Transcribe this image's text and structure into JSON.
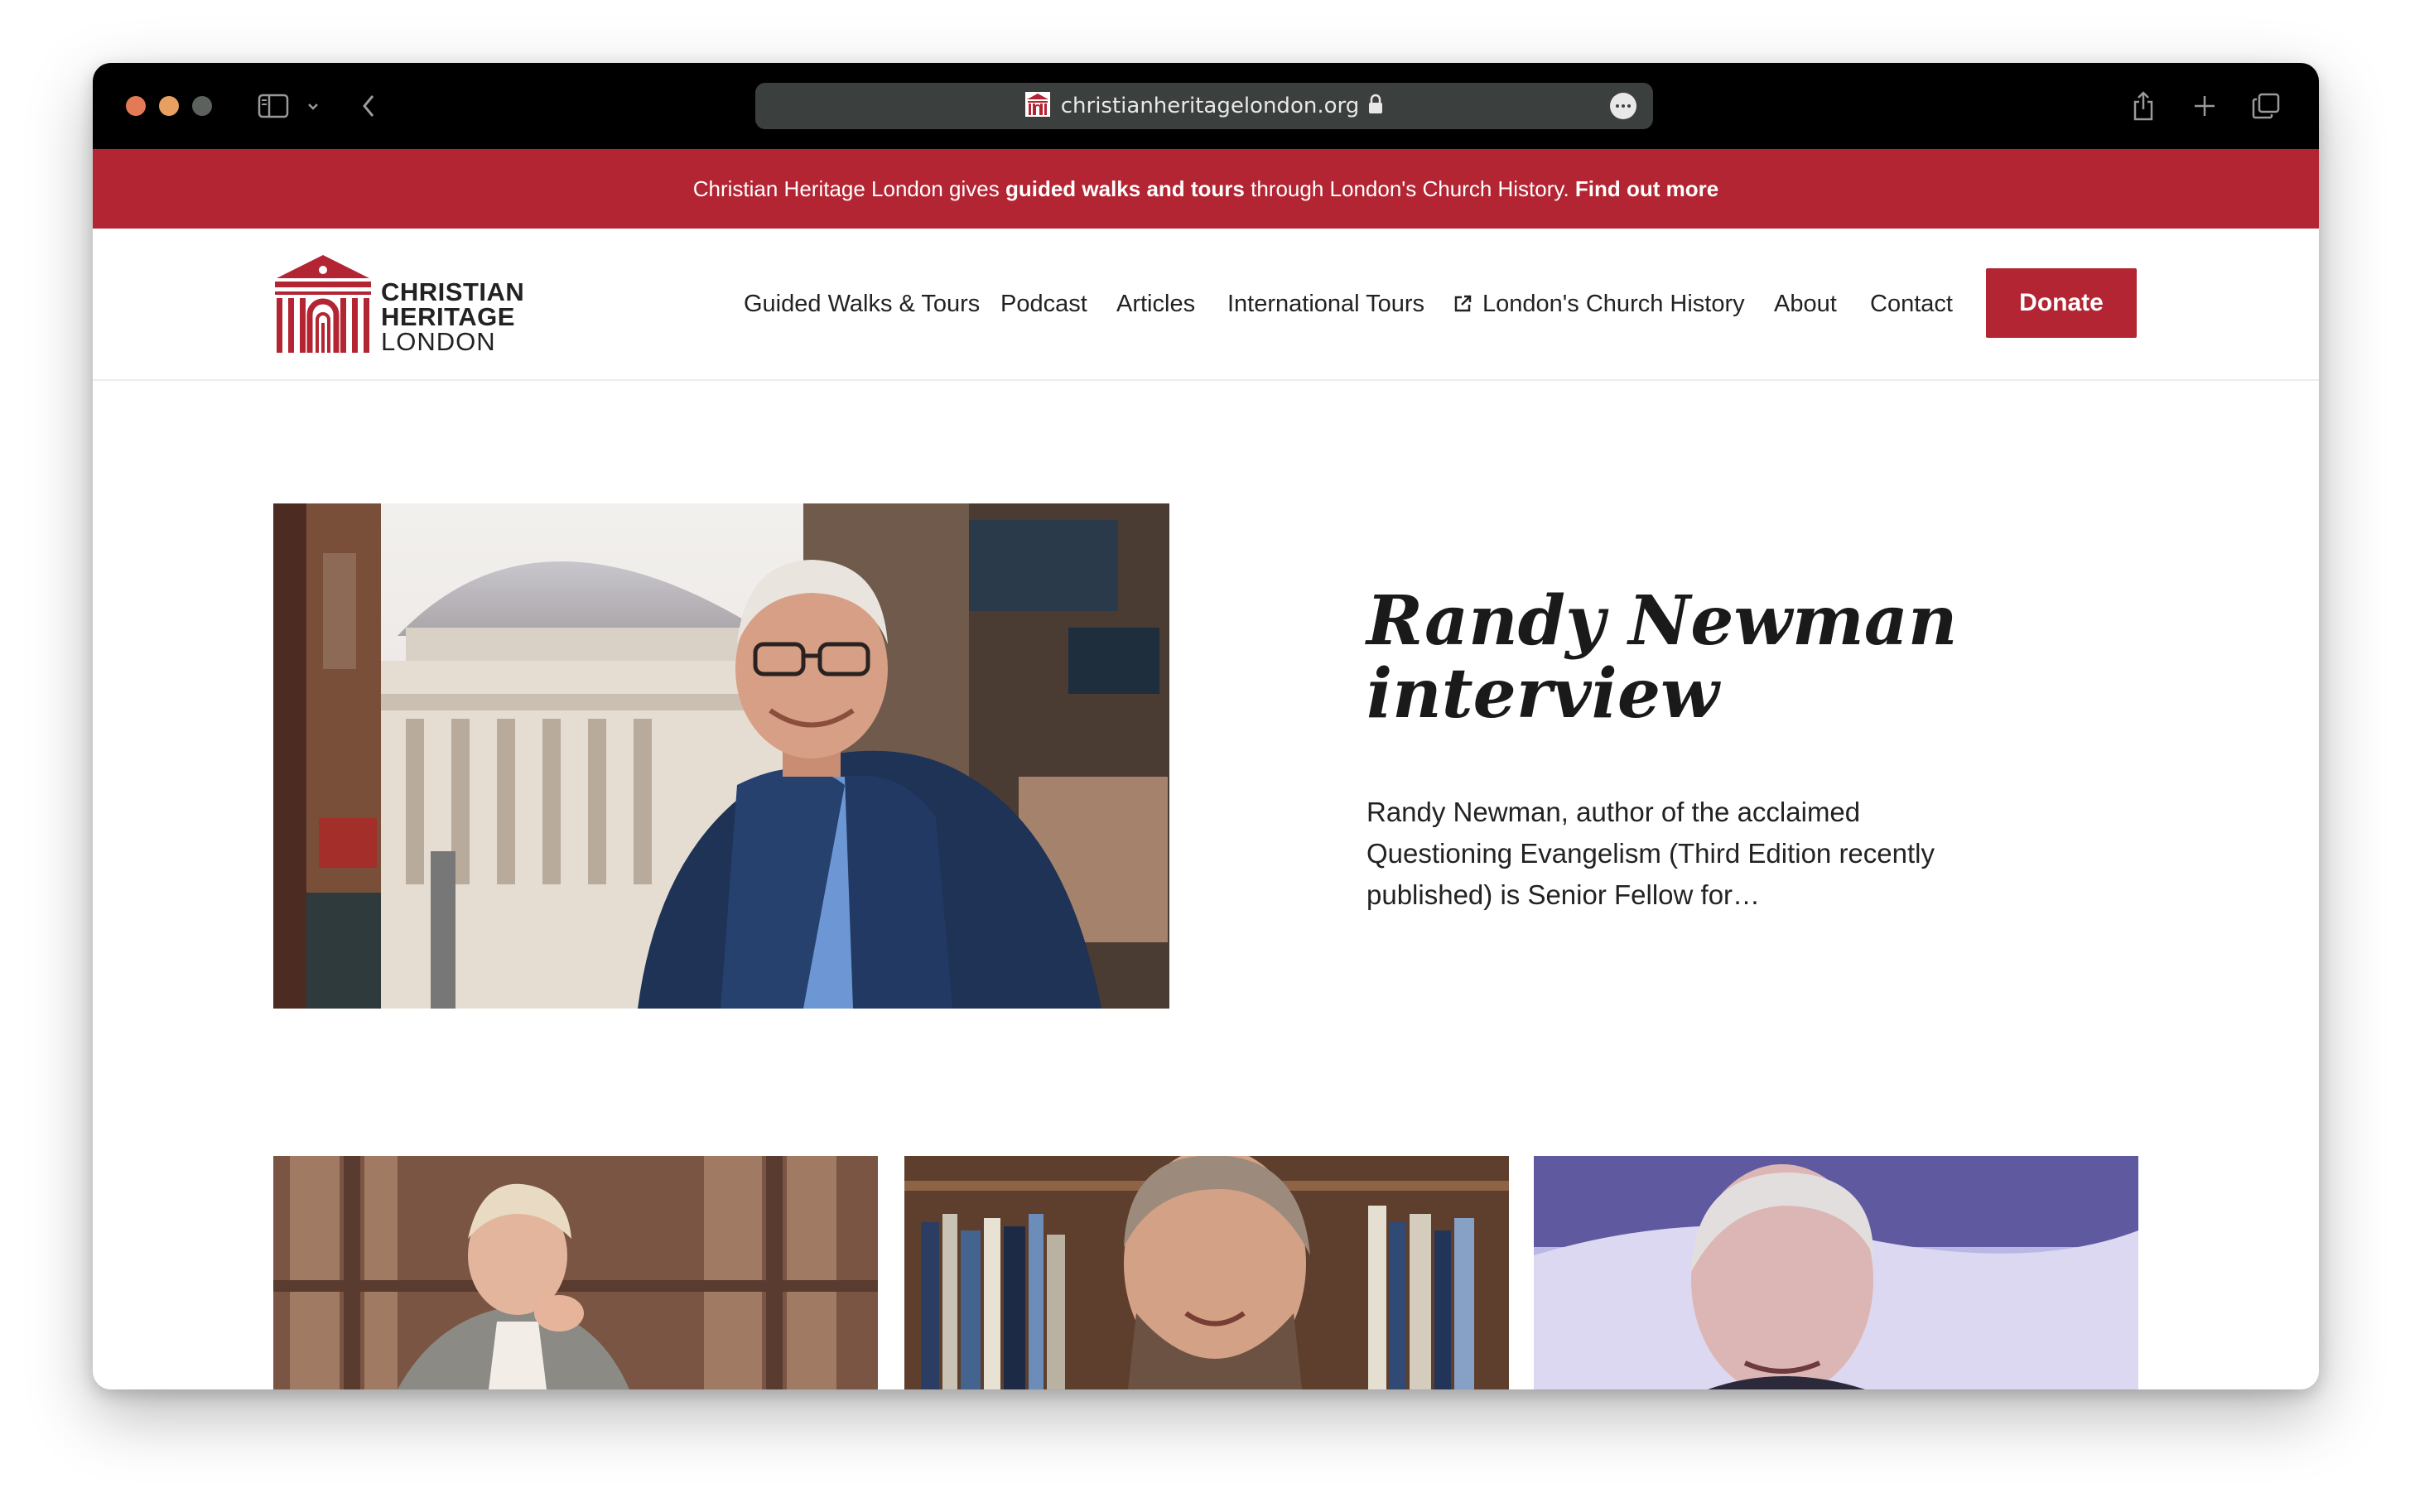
{
  "browser": {
    "url": "christianheritagelondon.org",
    "lock_icon": "lock-icon",
    "more_icon": "ellipsis-icon",
    "sidebar_icon": "sidebar-icon",
    "back_icon": "chevron-left-icon",
    "share_icon": "share-icon",
    "new_tab_icon": "plus-icon",
    "tabs_icon": "tabs-overview-icon"
  },
  "banner": {
    "part1": "Christian Heritage London gives ",
    "bold1": "guided walks and tours",
    "part2": " through London's Church History. ",
    "link": "Find out more"
  },
  "logo": {
    "line1": "CHRISTIAN",
    "line2": "HERITAGE",
    "line3": "LONDON"
  },
  "nav": {
    "items": [
      "Guided Walks & Tours",
      "Podcast",
      "Articles",
      "International Tours",
      "London's Church History",
      "About",
      "Contact"
    ],
    "external_icon": "external-link-icon",
    "donate": "Donate"
  },
  "hero": {
    "title_line1": "Randy Newman",
    "title_line2": "interview",
    "description": "Randy Newman, author of the acclaimed Questioning Evangelism (Third Edition recently published) is Senior Fellow for…"
  },
  "colors": {
    "brand_red": "#b32532",
    "titlebar": "#000000",
    "urlbar": "#3b3f3d"
  }
}
